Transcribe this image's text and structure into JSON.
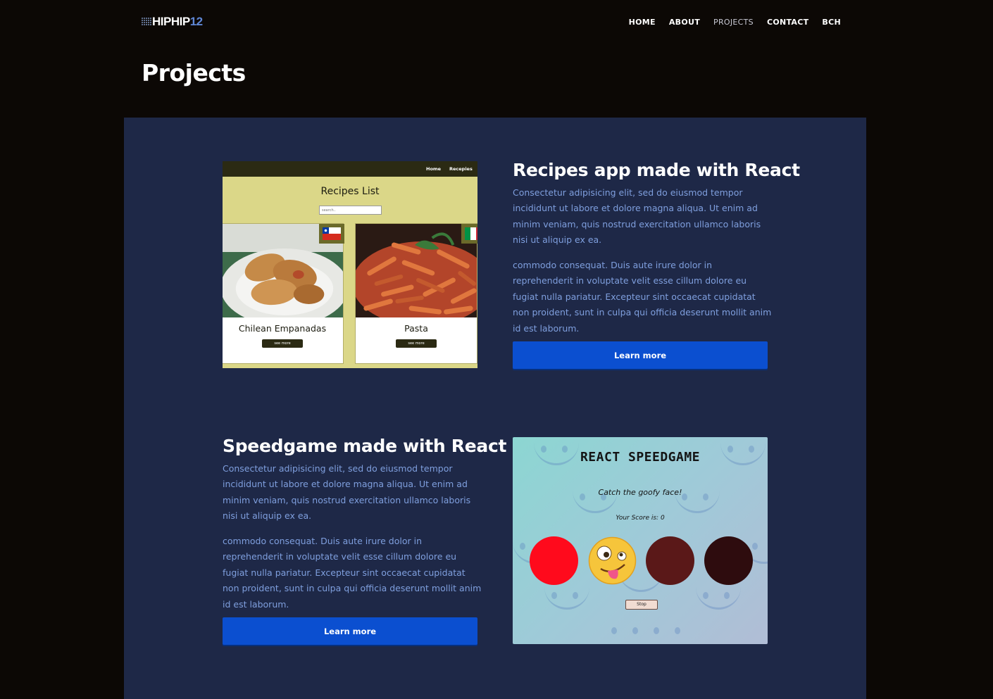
{
  "header": {
    "logo": {
      "main": "HIPHIP",
      "number": "12"
    },
    "nav": [
      {
        "label": "HOME",
        "active": false
      },
      {
        "label": "ABOUT",
        "active": false
      },
      {
        "label": "PROJECTS",
        "active": true
      },
      {
        "label": "CONTACT",
        "active": false
      },
      {
        "label": "BCH",
        "active": false
      }
    ]
  },
  "page": {
    "title": "Projects"
  },
  "projects": [
    {
      "title": "Recipes app made with React",
      "paragraph1": "Consectetur adipisicing elit, sed do eiusmod tempor incididunt ut labore et dolore magna aliqua. Ut enim ad minim veniam, quis nostrud exercitation ullamco laboris nisi ut aliquip ex ea.",
      "paragraph2": "commodo consequat. Duis aute irure dolor in reprehenderit in voluptate velit esse cillum dolore eu fugiat nulla pariatur. Excepteur sint occaecat cupidatat non proident, sunt in culpa qui officia deserunt mollit anim id est laborum.",
      "button": "Learn more",
      "preview": {
        "nav": [
          "Home",
          "Recepies"
        ],
        "heading": "Recipes List",
        "search_placeholder": "search..",
        "cards": [
          {
            "name": "Chilean Empanadas",
            "button": "see more"
          },
          {
            "name": "Pasta",
            "button": "see more"
          }
        ]
      }
    },
    {
      "title": "Speedgame made with React",
      "paragraph1": "Consectetur adipisicing elit, sed do eiusmod tempor incididunt ut labore et dolore magna aliqua. Ut enim ad minim veniam, quis nostrud exercitation ullamco laboris nisi ut aliquip ex ea.",
      "paragraph2": "commodo consequat. Duis aute irure dolor in reprehenderit in voluptate velit esse cillum dolore eu fugiat nulla pariatur. Excepteur sint occaecat cupidatat non proident, sunt in culpa qui officia deserunt mollit anim id est laborum.",
      "button": "Learn more",
      "preview": {
        "heading": "REACT SPEEDGAME",
        "subtitle": "Catch the goofy face!",
        "score": "Your Score is: 0",
        "stop_button": "Stop",
        "circle_colors": [
          "#ff0a1c",
          "emoji",
          "#5a1818",
          "#2e0c0e"
        ]
      }
    }
  ],
  "colors": {
    "background": "#0c0805",
    "panel": "#1e2847",
    "accent": "#0b4fd0",
    "body_text": "#7f9fde"
  }
}
